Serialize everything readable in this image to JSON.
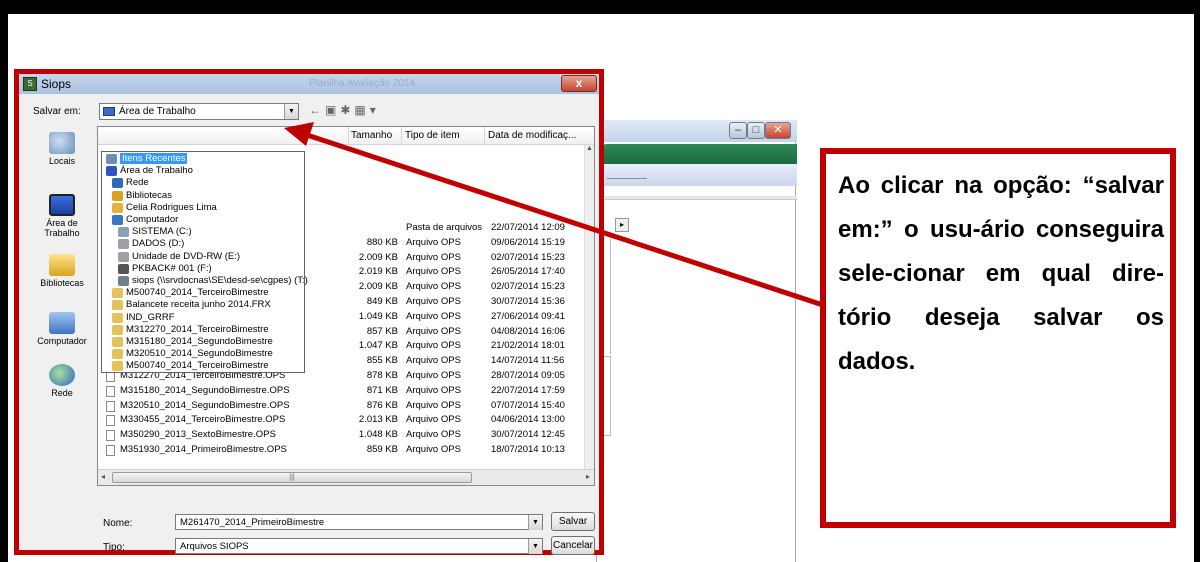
{
  "dialog": {
    "title": "Siops",
    "background_title": "Planilha Avaliação 2014",
    "close_label": "x"
  },
  "savein": {
    "label": "Salvar em:",
    "value": "Área de Trabalho"
  },
  "places": [
    {
      "label": "Locais",
      "icon": "recent-places-icon"
    },
    {
      "label": "Área de Trabalho",
      "icon": "desktop-icon"
    },
    {
      "label": "Bibliotecas",
      "icon": "libraries-icon"
    },
    {
      "label": "Computador",
      "icon": "computer-icon"
    },
    {
      "label": "Rede",
      "icon": "network-icon"
    }
  ],
  "columns": {
    "size": "Tamanho",
    "type": "Tipo de item",
    "date": "Data de modificaç..."
  },
  "files": [
    {
      "name": "",
      "size": "",
      "type": "Pasta de arquivos",
      "date": "22/07/2014 12:09"
    },
    {
      "name": "",
      "size": "880 KB",
      "type": "Arquivo OPS",
      "date": "09/06/2014 15:19"
    },
    {
      "name": "",
      "size": "2.009 KB",
      "type": "Arquivo OPS",
      "date": "02/07/2014 15:23"
    },
    {
      "name": "",
      "size": "2.019 KB",
      "type": "Arquivo OPS",
      "date": "26/05/2014 17:40"
    },
    {
      "name": "",
      "size": "2.009 KB",
      "type": "Arquivo OPS",
      "date": "02/07/2014 15:23"
    },
    {
      "name": "",
      "size": "849 KB",
      "type": "Arquivo OPS",
      "date": "30/07/2014 15:36"
    },
    {
      "name": "",
      "size": "1.049 KB",
      "type": "Arquivo OPS",
      "date": "27/06/2014 09:41"
    },
    {
      "name": "",
      "size": "857 KB",
      "type": "Arquivo OPS",
      "date": "04/08/2014 16:06"
    },
    {
      "name": "",
      "size": "1.047 KB",
      "type": "Arquivo OPS",
      "date": "21/02/2014 18:01"
    },
    {
      "name": "",
      "size": "855 KB",
      "type": "Arquivo OPS",
      "date": "14/07/2014 11:56"
    },
    {
      "name": "M312270_2014_TerceiroBimestre.OPS",
      "size": "878 KB",
      "type": "Arquivo OPS",
      "date": "28/07/2014 09:05"
    },
    {
      "name": "M315180_2014_SegundoBimestre.OPS",
      "size": "871 KB",
      "type": "Arquivo OPS",
      "date": "22/07/2014 17:59"
    },
    {
      "name": "M320510_2014_SegundoBimestre.OPS",
      "size": "876 KB",
      "type": "Arquivo OPS",
      "date": "07/07/2014 15:40"
    },
    {
      "name": "M330455_2014_TerceiroBimestre.OPS",
      "size": "2.013 KB",
      "type": "Arquivo OPS",
      "date": "04/06/2014 13:00"
    },
    {
      "name": "M350290_2013_SextoBimestre.OPS",
      "size": "1.048 KB",
      "type": "Arquivo OPS",
      "date": "30/07/2014 12:45"
    },
    {
      "name": "M351930_2014_PrimeiroBimestre.OPS",
      "size": "859 KB",
      "type": "Arquivo OPS",
      "date": "18/07/2014 10:13"
    }
  ],
  "dropdown": [
    {
      "label": "Itens Recentes",
      "icon": "recent-items-icon",
      "color": "#6b8fb7",
      "selected": true
    },
    {
      "label": "Área de Trabalho",
      "icon": "desktop-icon",
      "color": "#2b56c4"
    },
    {
      "label": "Rede",
      "icon": "network-icon",
      "color": "#2f67b9"
    },
    {
      "label": "Bibliotecas",
      "icon": "libraries-icon",
      "color": "#d9a321"
    },
    {
      "label": "Celia Rodrigues Lima",
      "icon": "user-folder-icon",
      "color": "#e1b53c"
    },
    {
      "label": "Computador",
      "icon": "computer-icon",
      "color": "#3d74c2"
    },
    {
      "label": "SISTEMA (C:)",
      "icon": "drive-icon",
      "color": "#8aa0b8"
    },
    {
      "label": "DADOS (D:)",
      "icon": "drive-icon",
      "color": "#9aa0a6"
    },
    {
      "label": "Unidade de DVD-RW (E:)",
      "icon": "dvd-drive-icon",
      "color": "#a0a0a0"
    },
    {
      "label": "PKBACK# 001 (F:)",
      "icon": "usb-drive-icon",
      "color": "#555555"
    },
    {
      "label": "siops (\\\\srvdocnas\\SE\\desd-se\\cgpes) (T:)",
      "icon": "network-drive-icon",
      "color": "#6f7f8f"
    },
    {
      "label": "M500740_2014_TerceiroBimestre",
      "icon": "folder-icon",
      "color": "#e5c15a"
    },
    {
      "label": "Balancete receita junho 2014.FRX",
      "icon": "folder-icon",
      "color": "#e5c15a"
    },
    {
      "label": "IND_GRRF",
      "icon": "folder-icon",
      "color": "#e5c15a"
    },
    {
      "label": "M312270_2014_TerceiroBimestre",
      "icon": "folder-icon",
      "color": "#e5c15a"
    },
    {
      "label": "M315180_2014_SegundoBimestre",
      "icon": "folder-icon",
      "color": "#e5c15a"
    },
    {
      "label": "M320510_2014_SegundoBimestre",
      "icon": "folder-icon",
      "color": "#e5c15a"
    },
    {
      "label": "M500740_2014_TerceiroBimestre",
      "icon": "folder-icon",
      "color": "#e5c15a"
    }
  ],
  "bottom": {
    "name_label": "Nome:",
    "name_value": "M261470_2014_PrimeiroBimestre",
    "type_label": "Tipo:",
    "type_value": "Arquivos SIOPS",
    "save_button": "Salvar",
    "cancel_button": "Cancelar"
  },
  "callout": {
    "text": "Ao clicar na opção: “salvar em:” o usu-ário conseguira sele-cionar em qual dire-tório deseja salvar os dados."
  },
  "colors": {
    "highlight_red": "#c00000",
    "selection_blue": "#3399ff"
  }
}
